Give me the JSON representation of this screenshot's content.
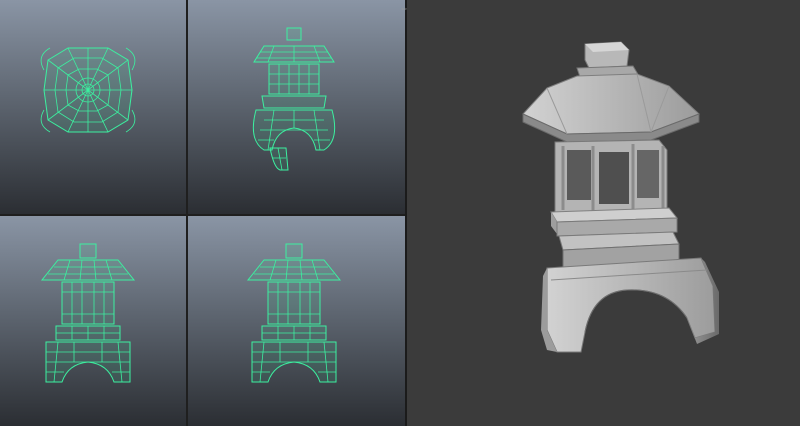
{
  "viewports": [
    {
      "id": "top",
      "mode": "wireframe"
    },
    {
      "id": "perspective",
      "mode": "wireframe"
    },
    {
      "id": "front",
      "mode": "wireframe"
    },
    {
      "id": "side",
      "mode": "wireframe"
    }
  ],
  "render_view": {
    "mode": "shaded"
  },
  "colors": {
    "wireframe": "#3cf0a0",
    "viewport_top": "#8a95a5",
    "viewport_bottom": "#2b2e33",
    "shaded_background": "#3b3b3b",
    "model_light": "#c8c8c8",
    "model_mid": "#9a9a9a",
    "model_dark": "#5e5e5e"
  },
  "icons": {
    "pane_toggle": "swap-arrows-icon"
  }
}
